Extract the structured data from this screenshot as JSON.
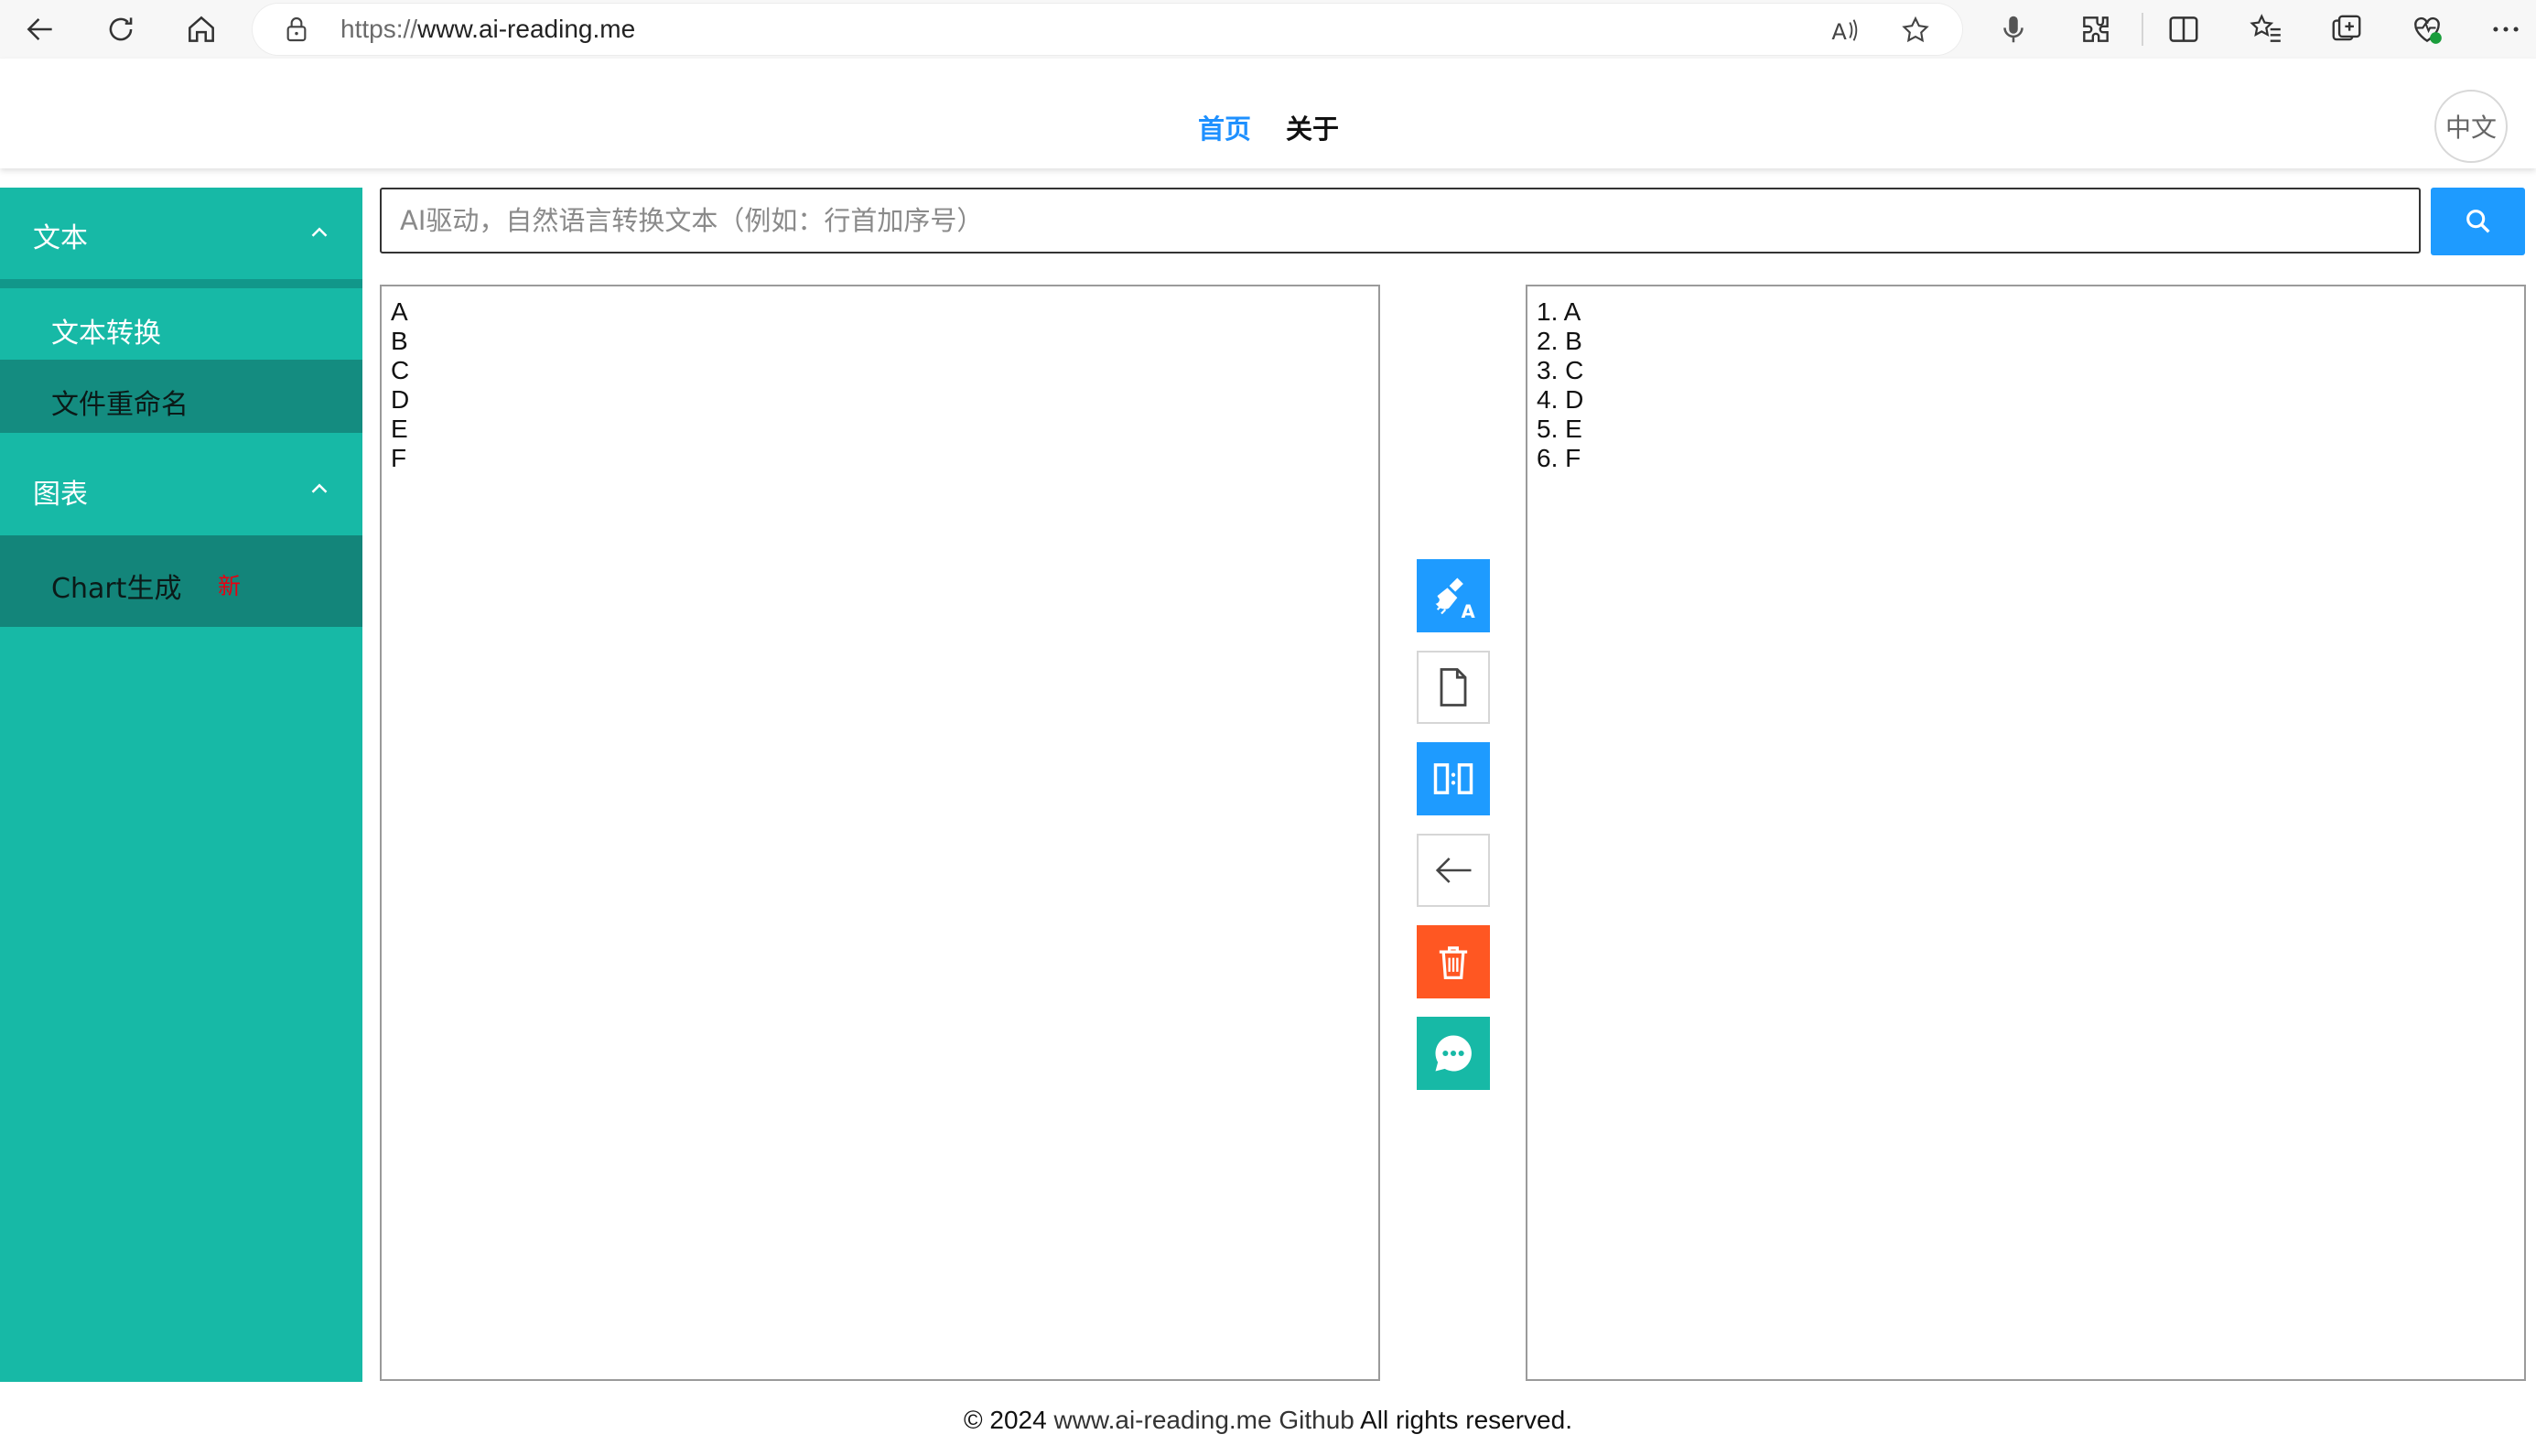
{
  "browser": {
    "url_protocol": "https://",
    "url_host": "www.ai-reading.me",
    "icons": [
      "back-icon",
      "refresh-icon",
      "home-icon",
      "lock-icon",
      "read-aloud-icon",
      "favorite-star-icon",
      "microphone-icon",
      "extensions-icon",
      "split-screen-icon",
      "favorites-icon",
      "collections-icon",
      "health-icon",
      "more-icon"
    ]
  },
  "header": {
    "nav_home": "首页",
    "nav_about": "关于",
    "lang": "中文"
  },
  "sidebar": {
    "groups": [
      {
        "label": "文本",
        "items": [
          {
            "label": "文本转换"
          },
          {
            "label": "文件重命名"
          }
        ]
      },
      {
        "label": "图表",
        "items": [
          {
            "label": "Chart生成",
            "badge": "新"
          }
        ]
      }
    ]
  },
  "search": {
    "placeholder": "AI驱动，自然语言转换文本（例如：行首加序号）",
    "value": ""
  },
  "input_lines": [
    "A",
    "B",
    "C",
    "D",
    "E",
    "F"
  ],
  "output_lines": [
    "1. A",
    "2. B",
    "3. C",
    "4. D",
    "5. E",
    "6. F"
  ],
  "tools": [
    "clean-format-icon",
    "new-document-icon",
    "compare-icon",
    "arrow-left-icon",
    "trash-icon",
    "chat-icon"
  ],
  "colors": {
    "teal": "#17b9a6",
    "blue": "#1e9bff",
    "red": "#ff5722",
    "nav_active": "#1e90ff"
  },
  "footer": {
    "copyright": "© 2024",
    "site": "www.ai-reading.me",
    "github": "Github",
    "rights": "All rights reserved."
  }
}
